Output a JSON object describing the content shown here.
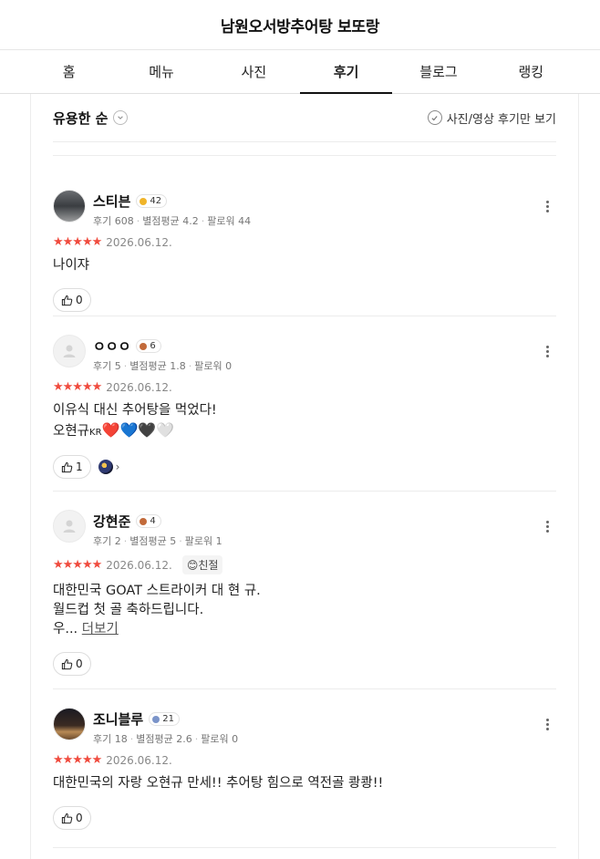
{
  "header": {
    "title": "남원오서방추어탕 보또랑"
  },
  "tabs": [
    {
      "label": "홈",
      "active": false
    },
    {
      "label": "메뉴",
      "active": false
    },
    {
      "label": "사진",
      "active": false
    },
    {
      "label": "후기",
      "active": true
    },
    {
      "label": "블로그",
      "active": false
    },
    {
      "label": "랭킹",
      "active": false
    }
  ],
  "sortbar": {
    "sort_label": "유용한 순",
    "filter_label": "사진/영상 후기만 보기"
  },
  "colors": {
    "star": "#f04b3e",
    "level_gold": "#f0b429",
    "level_bronze": "#c26a3a",
    "level_blue": "#7b94c9"
  },
  "reviews": [
    {
      "name": "스티븐",
      "level": "42",
      "level_color": "#f0b429",
      "stats": {
        "reviews": "후기 608",
        "avg": "별점평균 4.2",
        "followers": "팔로워 44"
      },
      "stars": "★★★★★",
      "date": "2026.06.12.",
      "text": "나이쟈",
      "likes": "0"
    },
    {
      "name": "ㅇㅇㅇ",
      "level": "6",
      "level_color": "#c26a3a",
      "stats": {
        "reviews": "후기 5",
        "avg": "별점평균 1.8",
        "followers": "팔로워 0"
      },
      "stars": "★★★★★",
      "date": "2026.06.12.",
      "text_line1": "이유식 대신 추어탕을 먹었다!",
      "text_line2_prefix": "오현규",
      "text_line2_kr": "KR",
      "hearts": "❤️💙🖤🤍",
      "likes": "1"
    },
    {
      "name": "강현준",
      "level": "4",
      "level_color": "#c26a3a",
      "stats": {
        "reviews": "후기 2",
        "avg": "별점평균 5",
        "followers": "팔로워 1"
      },
      "stars": "★★★★★",
      "date": "2026.06.12.",
      "tag": "😊친절",
      "text_line1": "대한민국 GOAT 스트라이커 대 현 규.",
      "text_line2": "월드컵 첫 골 축하드립니다.",
      "text_line3": "우...",
      "more_label": "더보기",
      "likes": "0"
    },
    {
      "name": "조니블루",
      "level": "21",
      "level_color": "#7b94c9",
      "stats": {
        "reviews": "후기 18",
        "avg": "별점평균 2.6",
        "followers": "팔로워 0"
      },
      "stars": "★★★★★",
      "date": "2026.06.12.",
      "text": "대한민국의 자랑 오현규 만세!! 추어탕 힘으로 역전골 쾅쾅!!",
      "likes": "0"
    }
  ]
}
